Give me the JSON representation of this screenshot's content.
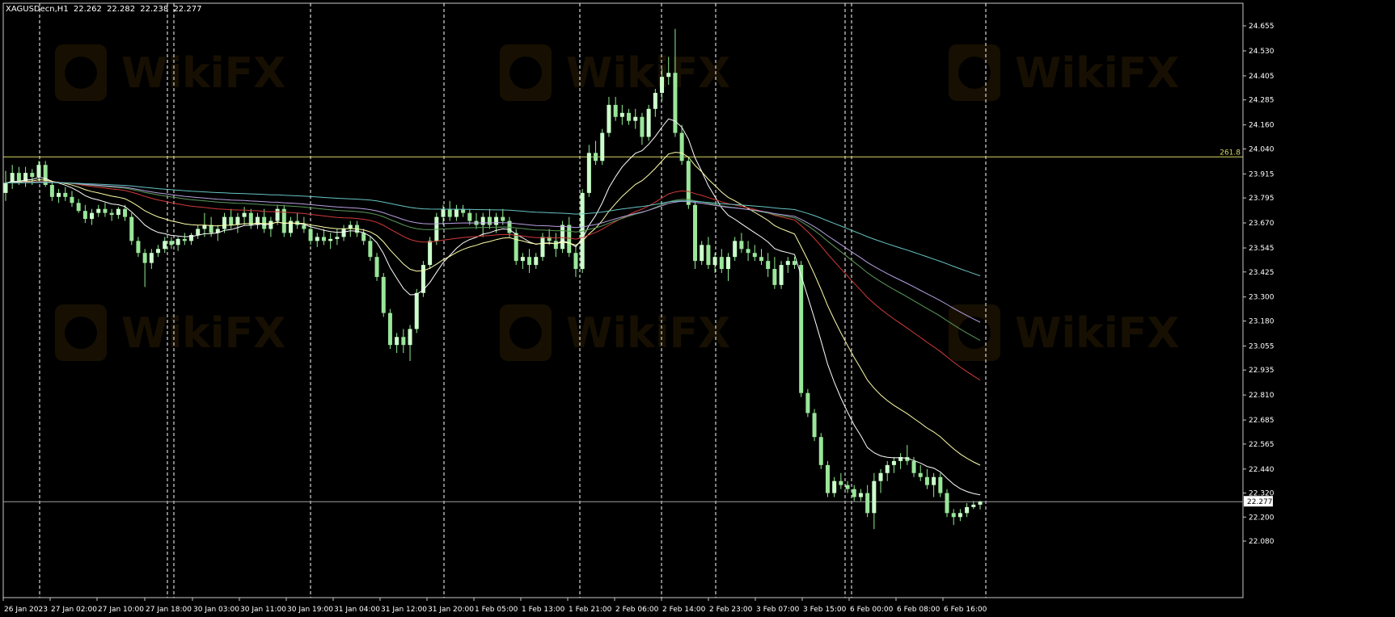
{
  "header": {
    "symbol": "XAGUSDecn,H1",
    "open": "22.262",
    "high": "22.282",
    "low": "22.238",
    "close": "22.277"
  },
  "watermark": {
    "text": "WikiFX"
  },
  "colors": {
    "background": "#000000",
    "frame": "#c8c8c8",
    "grid_sep": "#ffffff",
    "bull_candle": "#ccffcc",
    "bear_candle": "#99e699",
    "wick": "#90ee90",
    "fib_line": "#d8d860",
    "current_price_line": "#a0a0a0",
    "ma_fast": "#ffffff",
    "ma_mid": "#ffffaa",
    "ma_teal": "#67c4c4",
    "ma_red": "#d23a3a",
    "ma_purple": "#b8a0e0",
    "ma_green": "#5a9a5a",
    "ma_darkred": "#a02020"
  },
  "chart_data": {
    "type": "candlestick",
    "instrument": "XAGUSDecn",
    "timeframe": "H1",
    "price_axis": {
      "ticks": [
        "24.655",
        "24.530",
        "24.405",
        "24.285",
        "24.160",
        "24.040",
        "23.915",
        "23.795",
        "23.670",
        "23.545",
        "23.425",
        "23.300",
        "23.180",
        "23.055",
        "22.935",
        "22.810",
        "22.685",
        "22.565",
        "22.440",
        "22.320",
        "22.200",
        "22.080"
      ],
      "range": [
        22.08,
        24.72
      ]
    },
    "time_axis": {
      "labels": [
        "26 Jan 2023",
        "27 Jan 02:00",
        "27 Jan 10:00",
        "27 Jan 18:00",
        "30 Jan 03:00",
        "30 Jan 11:00",
        "30 Jan 19:00",
        "31 Jan 04:00",
        "31 Jan 12:00",
        "31 Jan 20:00",
        "1 Feb 05:00",
        "1 Feb 13:00",
        "1 Feb 21:00",
        "2 Feb 06:00",
        "2 Feb 14:00",
        "2 Feb 23:00",
        "3 Feb 07:00",
        "3 Feb 15:00",
        "6 Feb 00:00",
        "6 Feb 08:00",
        "6 Feb 16:00"
      ]
    },
    "fibonacci_level": {
      "label": "261.8",
      "price": 24.0
    },
    "current_price": "22.277",
    "candles": [
      [
        23.82,
        23.93,
        23.78,
        23.87
      ],
      [
        23.87,
        23.96,
        23.84,
        23.92
      ],
      [
        23.92,
        23.95,
        23.86,
        23.88
      ],
      [
        23.88,
        23.95,
        23.85,
        23.92
      ],
      [
        23.92,
        23.94,
        23.86,
        23.9
      ],
      [
        23.9,
        23.98,
        23.88,
        23.96
      ],
      [
        23.96,
        23.98,
        23.85,
        23.86
      ],
      [
        23.86,
        23.88,
        23.78,
        23.8
      ],
      [
        23.8,
        23.84,
        23.77,
        23.82
      ],
      [
        23.82,
        23.85,
        23.78,
        23.8
      ],
      [
        23.8,
        23.83,
        23.75,
        23.77
      ],
      [
        23.77,
        23.79,
        23.72,
        23.73
      ],
      [
        23.73,
        23.76,
        23.67,
        23.69
      ],
      [
        23.69,
        23.74,
        23.66,
        23.72
      ],
      [
        23.72,
        23.76,
        23.7,
        23.74
      ],
      [
        23.74,
        23.77,
        23.7,
        23.72
      ],
      [
        23.72,
        23.74,
        23.68,
        23.71
      ],
      [
        23.71,
        23.75,
        23.69,
        23.74
      ],
      [
        23.74,
        23.76,
        23.68,
        23.7
      ],
      [
        23.7,
        23.72,
        23.56,
        23.58
      ],
      [
        23.58,
        23.6,
        23.5,
        23.52
      ],
      [
        23.52,
        23.54,
        23.35,
        23.47
      ],
      [
        23.47,
        23.54,
        23.44,
        23.52
      ],
      [
        23.52,
        23.56,
        23.5,
        23.54
      ],
      [
        23.54,
        23.6,
        23.52,
        23.58
      ],
      [
        23.58,
        23.6,
        23.54,
        23.56
      ],
      [
        23.56,
        23.6,
        23.53,
        23.59
      ],
      [
        23.59,
        23.62,
        23.56,
        23.58
      ],
      [
        23.58,
        23.62,
        23.56,
        23.61
      ],
      [
        23.61,
        23.66,
        23.59,
        23.64
      ],
      [
        23.64,
        23.72,
        23.6,
        23.66
      ],
      [
        23.66,
        23.7,
        23.6,
        23.62
      ],
      [
        23.62,
        23.66,
        23.58,
        23.64
      ],
      [
        23.64,
        23.72,
        23.62,
        23.7
      ],
      [
        23.7,
        23.74,
        23.64,
        23.66
      ],
      [
        23.66,
        23.72,
        23.62,
        23.7
      ],
      [
        23.7,
        23.75,
        23.66,
        23.72
      ],
      [
        23.72,
        23.74,
        23.64,
        23.66
      ],
      [
        23.66,
        23.72,
        23.64,
        23.7
      ],
      [
        23.7,
        23.74,
        23.62,
        23.64
      ],
      [
        23.64,
        23.7,
        23.6,
        23.68
      ],
      [
        23.68,
        23.76,
        23.66,
        23.74
      ],
      [
        23.74,
        23.76,
        23.6,
        23.62
      ],
      [
        23.62,
        23.7,
        23.6,
        23.68
      ],
      [
        23.68,
        23.72,
        23.64,
        23.66
      ],
      [
        23.66,
        23.7,
        23.62,
        23.64
      ],
      [
        23.64,
        23.66,
        23.56,
        23.58
      ],
      [
        23.58,
        23.62,
        23.55,
        23.6
      ],
      [
        23.6,
        23.64,
        23.56,
        23.58
      ],
      [
        23.58,
        23.62,
        23.54,
        23.59
      ],
      [
        23.59,
        23.64,
        23.56,
        23.6
      ],
      [
        23.6,
        23.66,
        23.58,
        23.64
      ],
      [
        23.64,
        23.68,
        23.6,
        23.66
      ],
      [
        23.66,
        23.68,
        23.6,
        23.62
      ],
      [
        23.62,
        23.64,
        23.56,
        23.58
      ],
      [
        23.58,
        23.6,
        23.48,
        23.5
      ],
      [
        23.5,
        23.52,
        23.38,
        23.4
      ],
      [
        23.4,
        23.42,
        23.2,
        23.22
      ],
      [
        23.22,
        23.24,
        23.04,
        23.06
      ],
      [
        23.06,
        23.12,
        23.02,
        23.1
      ],
      [
        23.1,
        23.14,
        23.02,
        23.06
      ],
      [
        23.06,
        23.16,
        22.98,
        23.14
      ],
      [
        23.14,
        23.34,
        23.12,
        23.32
      ],
      [
        23.32,
        23.48,
        23.3,
        23.46
      ],
      [
        23.46,
        23.6,
        23.44,
        23.58
      ],
      [
        23.58,
        23.72,
        23.56,
        23.7
      ],
      [
        23.7,
        23.76,
        23.66,
        23.74
      ],
      [
        23.74,
        23.78,
        23.68,
        23.7
      ],
      [
        23.7,
        23.76,
        23.68,
        23.74
      ],
      [
        23.74,
        23.76,
        23.7,
        23.72
      ],
      [
        23.72,
        23.74,
        23.66,
        23.68
      ],
      [
        23.68,
        23.72,
        23.64,
        23.66
      ],
      [
        23.66,
        23.72,
        23.6,
        23.7
      ],
      [
        23.7,
        23.74,
        23.64,
        23.66
      ],
      [
        23.66,
        23.72,
        23.62,
        23.7
      ],
      [
        23.7,
        23.74,
        23.66,
        23.68
      ],
      [
        23.68,
        23.7,
        23.6,
        23.62
      ],
      [
        23.62,
        23.64,
        23.46,
        23.48
      ],
      [
        23.48,
        23.52,
        23.44,
        23.5
      ],
      [
        23.5,
        23.54,
        23.42,
        23.46
      ],
      [
        23.46,
        23.52,
        23.44,
        23.5
      ],
      [
        23.5,
        23.62,
        23.48,
        23.6
      ],
      [
        23.6,
        23.64,
        23.56,
        23.58
      ],
      [
        23.58,
        23.62,
        23.5,
        23.54
      ],
      [
        23.54,
        23.68,
        23.52,
        23.66
      ],
      [
        23.66,
        23.7,
        23.5,
        23.52
      ],
      [
        23.52,
        23.56,
        23.4,
        23.44
      ],
      [
        23.44,
        23.84,
        23.42,
        23.82
      ],
      [
        23.82,
        24.06,
        23.8,
        24.02
      ],
      [
        24.02,
        24.08,
        23.96,
        23.98
      ],
      [
        23.98,
        24.14,
        23.96,
        24.12
      ],
      [
        24.12,
        24.3,
        24.1,
        24.26
      ],
      [
        24.26,
        24.3,
        24.18,
        24.2
      ],
      [
        24.2,
        24.26,
        24.16,
        24.22
      ],
      [
        24.22,
        24.24,
        24.16,
        24.18
      ],
      [
        24.18,
        24.24,
        24.14,
        24.2
      ],
      [
        24.2,
        24.22,
        24.06,
        24.1
      ],
      [
        24.1,
        24.26,
        24.08,
        24.24
      ],
      [
        24.24,
        24.34,
        24.2,
        24.32
      ],
      [
        24.32,
        24.44,
        24.28,
        24.4
      ],
      [
        24.4,
        24.5,
        24.36,
        24.42
      ],
      [
        24.42,
        24.64,
        24.1,
        24.12
      ],
      [
        24.12,
        24.16,
        23.96,
        23.98
      ],
      [
        23.98,
        24.0,
        23.74,
        23.76
      ],
      [
        23.76,
        23.78,
        23.44,
        23.48
      ],
      [
        23.48,
        23.58,
        23.46,
        23.56
      ],
      [
        23.56,
        23.6,
        23.44,
        23.46
      ],
      [
        23.46,
        23.52,
        23.42,
        23.5
      ],
      [
        23.5,
        23.54,
        23.42,
        23.44
      ],
      [
        23.44,
        23.52,
        23.38,
        23.5
      ],
      [
        23.5,
        23.6,
        23.48,
        23.58
      ],
      [
        23.58,
        23.62,
        23.52,
        23.54
      ],
      [
        23.54,
        23.58,
        23.48,
        23.52
      ],
      [
        23.52,
        23.56,
        23.48,
        23.5
      ],
      [
        23.5,
        23.54,
        23.46,
        23.48
      ],
      [
        23.48,
        23.52,
        23.4,
        23.44
      ],
      [
        23.44,
        23.5,
        23.34,
        23.36
      ],
      [
        23.36,
        23.48,
        23.34,
        23.46
      ],
      [
        23.46,
        23.5,
        23.42,
        23.48
      ],
      [
        23.48,
        23.5,
        23.44,
        23.46
      ],
      [
        23.46,
        23.48,
        22.8,
        22.82
      ],
      [
        22.82,
        22.84,
        22.7,
        22.72
      ],
      [
        22.72,
        22.74,
        22.58,
        22.6
      ],
      [
        22.6,
        22.62,
        22.44,
        22.46
      ],
      [
        22.46,
        22.48,
        22.3,
        22.32
      ],
      [
        22.32,
        22.4,
        22.3,
        22.38
      ],
      [
        22.38,
        22.42,
        22.34,
        22.36
      ],
      [
        22.36,
        22.38,
        22.32,
        22.34
      ],
      [
        22.34,
        22.36,
        22.28,
        22.3
      ],
      [
        22.3,
        22.34,
        22.28,
        22.32
      ],
      [
        22.32,
        22.36,
        22.2,
        22.22
      ],
      [
        22.22,
        22.42,
        22.14,
        22.38
      ],
      [
        22.38,
        22.44,
        22.32,
        22.42
      ],
      [
        22.42,
        22.48,
        22.38,
        22.46
      ],
      [
        22.46,
        22.5,
        22.42,
        22.48
      ],
      [
        22.48,
        22.52,
        22.44,
        22.5
      ],
      [
        22.5,
        22.56,
        22.46,
        22.48
      ],
      [
        22.48,
        22.5,
        22.4,
        22.42
      ],
      [
        22.42,
        22.46,
        22.38,
        22.4
      ],
      [
        22.4,
        22.44,
        22.34,
        22.36
      ],
      [
        22.36,
        22.42,
        22.3,
        22.4
      ],
      [
        22.4,
        22.42,
        22.3,
        22.32
      ],
      [
        22.32,
        22.34,
        22.2,
        22.22
      ],
      [
        22.22,
        22.24,
        22.16,
        22.2
      ],
      [
        22.2,
        22.24,
        22.18,
        22.22
      ],
      [
        22.22,
        22.27,
        22.2,
        22.25
      ],
      [
        22.25,
        22.28,
        22.24,
        22.262
      ],
      [
        22.262,
        22.282,
        22.238,
        22.277
      ]
    ]
  }
}
